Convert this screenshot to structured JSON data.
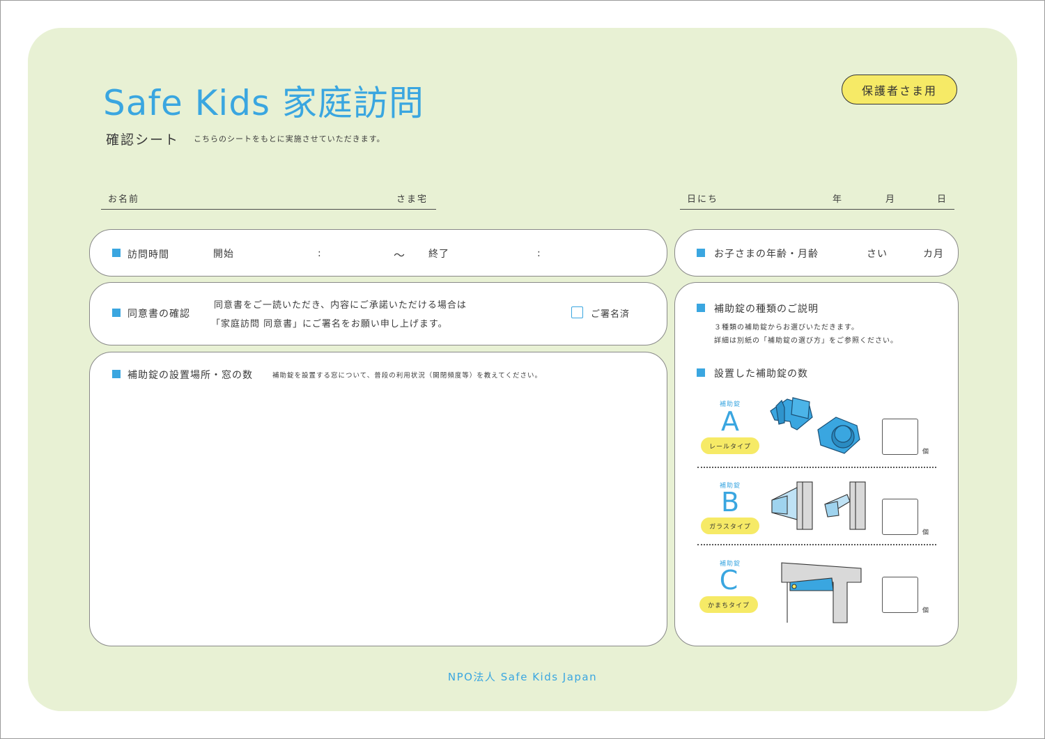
{
  "header": {
    "title": "Safe Kids 家庭訪問",
    "subtitle": "確認シート",
    "subnote": "こちらのシートをもとに実施させていただきます。",
    "badge": "保護者さま用"
  },
  "name_field": {
    "label": "お名前",
    "suffix": "さま宅"
  },
  "date_field": {
    "label": "日にち",
    "year": "年",
    "month": "月",
    "day": "日"
  },
  "visit_time": {
    "label": "訪問時間",
    "start": "開始",
    "colon1": ":",
    "tilde": "〜",
    "end": "終了",
    "colon2": ":"
  },
  "child_age": {
    "label": "お子さまの年齢・月齢",
    "years": "さい",
    "months": "カ月"
  },
  "consent": {
    "label": "同意書の確認",
    "line1": "同意書をご一読いただき、内容にご承諾いただける場合は",
    "line2": "「家庭訪問 同意書」にご署名をお願い申し上げます。",
    "checkbox_label": "ご署名済"
  },
  "install_location": {
    "label": "補助錠の設置場所・窓の数",
    "note": "補助錠を設置する窓について、普段の利用状況（開閉頻度等）を教えてください。"
  },
  "lock_types": {
    "label": "補助錠の種類のご説明",
    "desc1": "３種類の補助錠からお選びいただきます。",
    "desc2": "詳細は別紙の「補助錠の選び方」をご参照ください。",
    "count_label": "設置した補助錠の数",
    "types": [
      {
        "small": "補助錠",
        "letter": "A",
        "pill": "レールタイプ",
        "unit": "個"
      },
      {
        "small": "補助錠",
        "letter": "B",
        "pill": "ガラスタイプ",
        "unit": "個"
      },
      {
        "small": "補助錠",
        "letter": "C",
        "pill": "かまちタイプ",
        "unit": "個"
      }
    ]
  },
  "footer": "NPO法人 Safe Kids Japan",
  "colors": {
    "accent": "#3aa6e0",
    "background": "#e8f1d4",
    "highlight": "#f6ea66"
  }
}
